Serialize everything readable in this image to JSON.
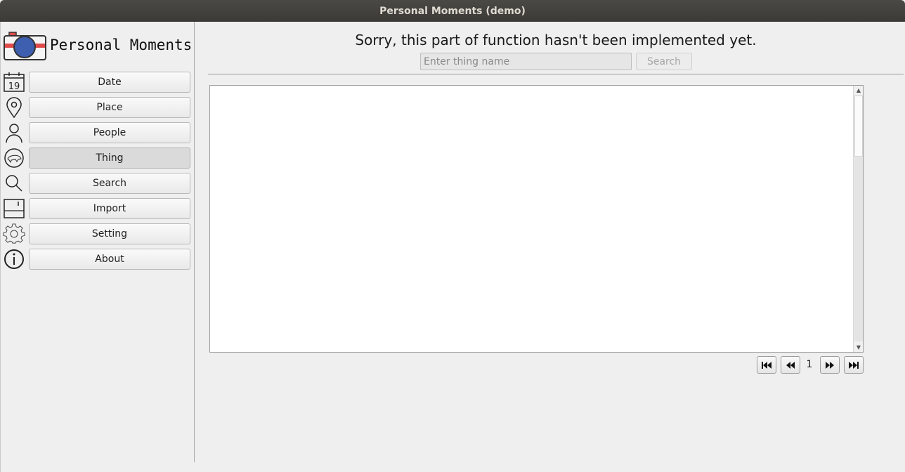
{
  "window": {
    "title": "Personal Moments (demo)"
  },
  "sidebar": {
    "app_name": "Personal Moments",
    "items": [
      {
        "label": "Date",
        "icon": "calendar-icon",
        "icon_text": "19"
      },
      {
        "label": "Place",
        "icon": "map-pin-icon"
      },
      {
        "label": "People",
        "icon": "person-icon"
      },
      {
        "label": "Thing",
        "icon": "thing-icon",
        "active": true
      },
      {
        "label": "Search",
        "icon": "search-icon"
      },
      {
        "label": "Import",
        "icon": "save-icon"
      },
      {
        "label": "Setting",
        "icon": "gear-icon"
      },
      {
        "label": "About",
        "icon": "info-icon"
      }
    ]
  },
  "main": {
    "notice": "Sorry, this part of function hasn't been implemented yet.",
    "search": {
      "placeholder": "Enter thing name",
      "value": "",
      "button_label": "Search"
    },
    "pager": {
      "page": "1"
    }
  },
  "colors": {
    "logo_red": "#e04a4a",
    "logo_blue": "#3e5fb0",
    "titlebar": "#3f3e3a"
  }
}
